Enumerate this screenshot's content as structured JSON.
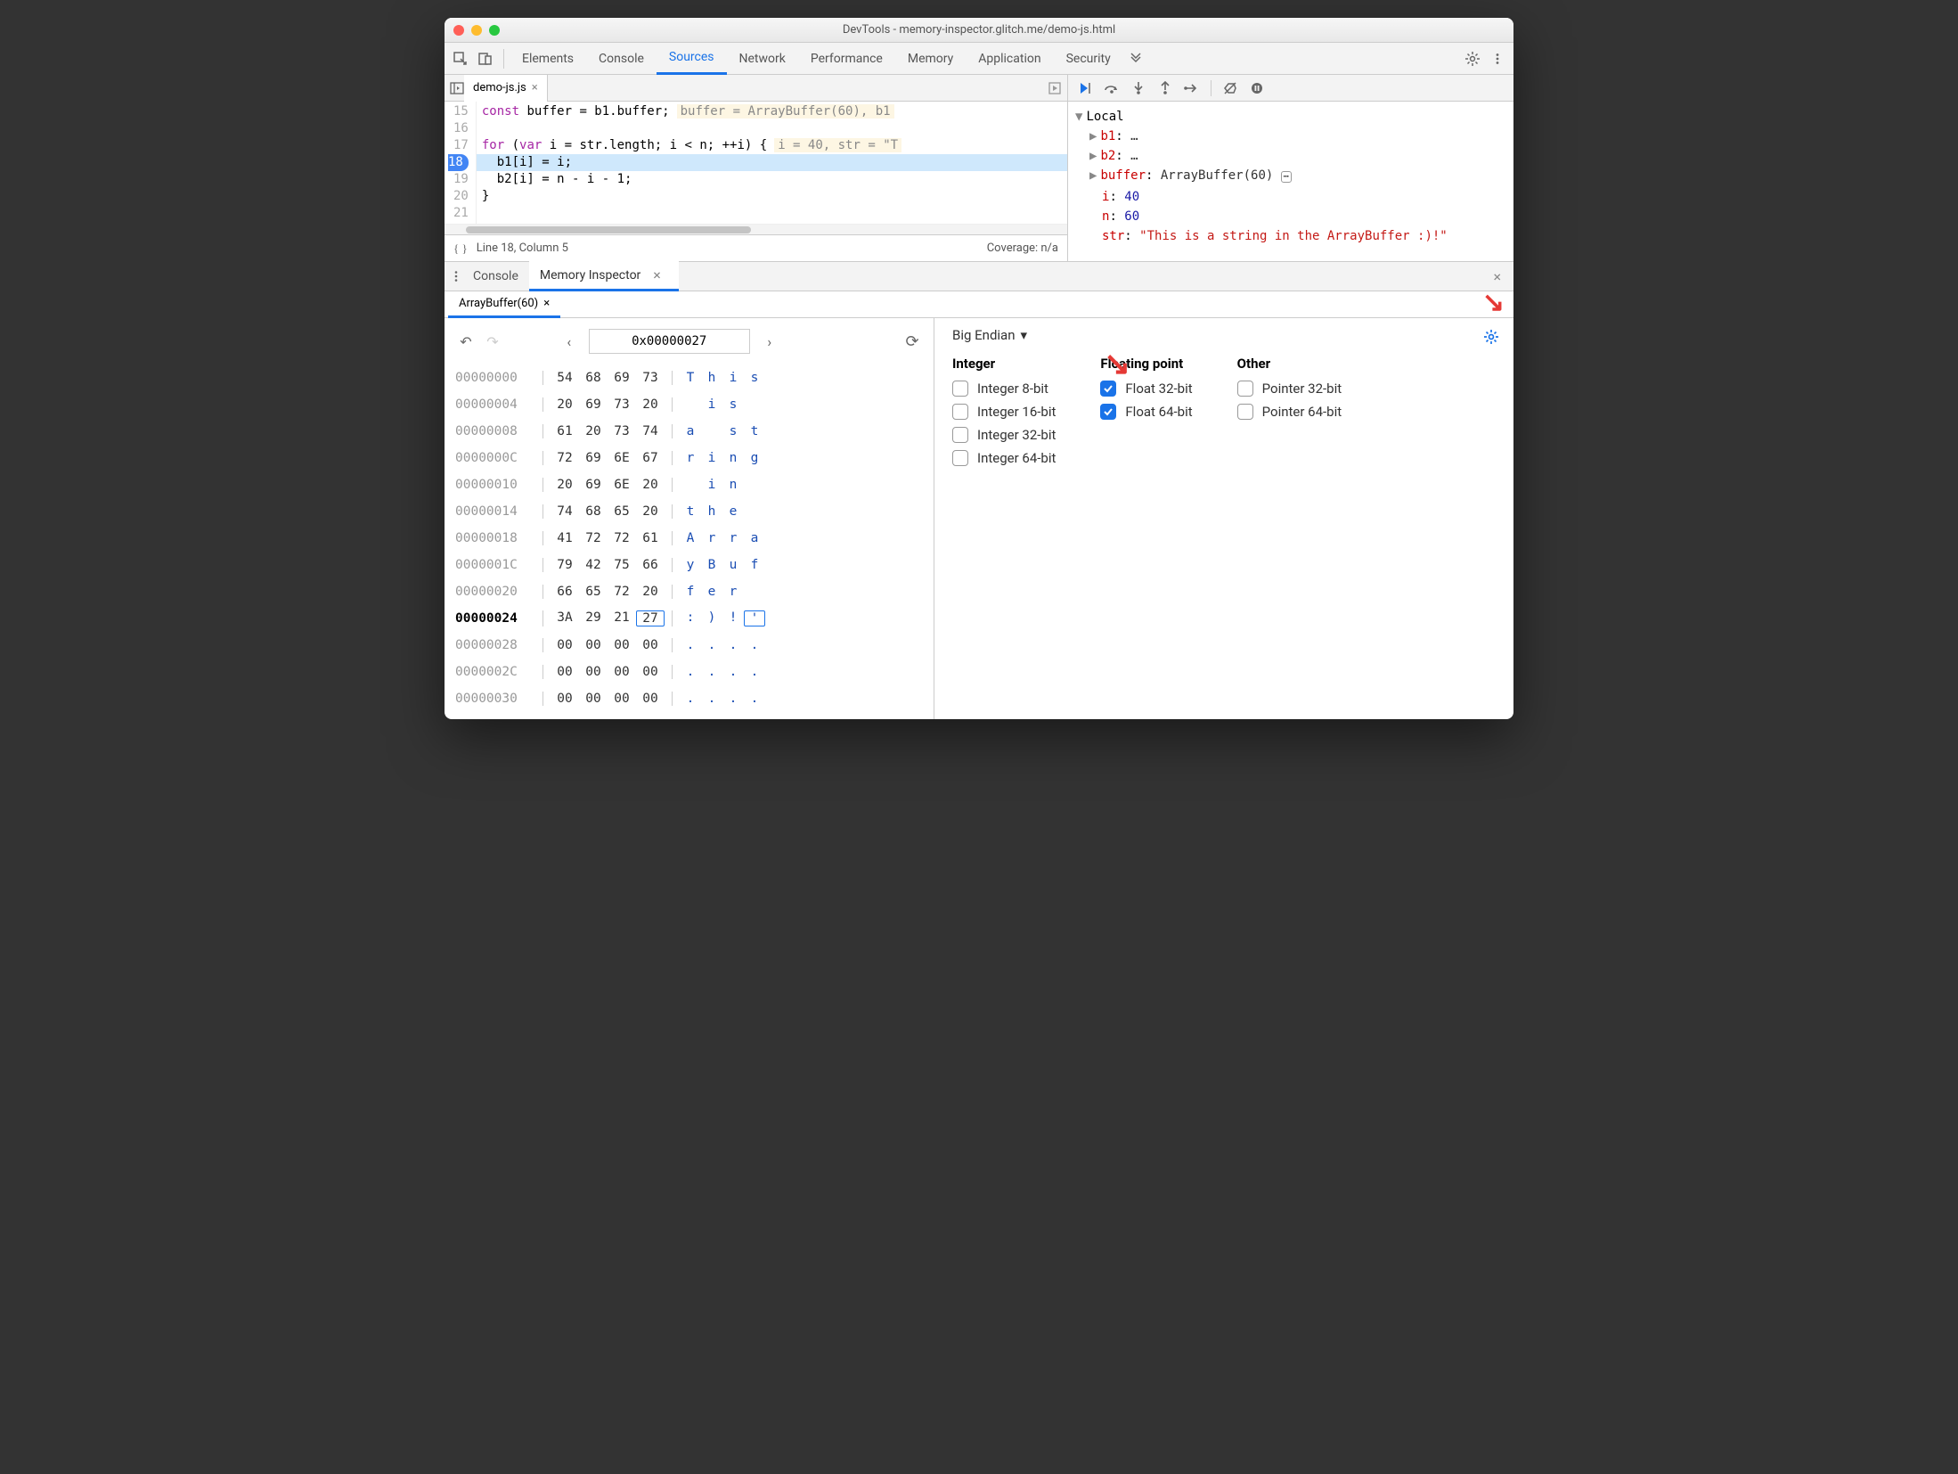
{
  "window": {
    "title": "DevTools - memory-inspector.glitch.me/demo-js.html"
  },
  "tabs": [
    "Elements",
    "Console",
    "Sources",
    "Network",
    "Performance",
    "Memory",
    "Application",
    "Security"
  ],
  "active_tab": "Sources",
  "file_tab": {
    "name": "demo-js.js"
  },
  "code": {
    "lines": [
      {
        "n": 15,
        "text": "const buffer = b1.buffer;",
        "hint": "buffer = ArrayBuffer(60), b1"
      },
      {
        "n": 16,
        "text": ""
      },
      {
        "n": 17,
        "text": "for (var i = str.length; i < n; ++i) {",
        "hint": "i = 40, str = \"T"
      },
      {
        "n": 18,
        "text": "  b1[i] = i;",
        "bp": true
      },
      {
        "n": 19,
        "text": "  b2[i] = n - i - 1;"
      },
      {
        "n": 20,
        "text": "}"
      },
      {
        "n": 21,
        "text": ""
      }
    ],
    "status": {
      "pos": "Line 18, Column 5",
      "coverage": "Coverage: n/a"
    }
  },
  "scope": {
    "title": "Local",
    "items": [
      {
        "k": "b1",
        "v": "…",
        "expandable": true
      },
      {
        "k": "b2",
        "v": "…",
        "expandable": true
      },
      {
        "k": "buffer",
        "v": "ArrayBuffer(60)",
        "icon": true,
        "expandable": true
      },
      {
        "k": "i",
        "v": "40",
        "num": true
      },
      {
        "k": "n",
        "v": "60",
        "num": true
      },
      {
        "k": "str",
        "v": "\"This is a string in the ArrayBuffer :)!\"",
        "str": true
      }
    ]
  },
  "drawer": {
    "tabs": [
      "Console",
      "Memory Inspector"
    ],
    "active": "Memory Inspector"
  },
  "mi": {
    "buffer_tab": "ArrayBuffer(60)",
    "address": "0x00000027",
    "endian": "Big Endian",
    "rows": [
      {
        "addr": "00000000",
        "bytes": [
          "54",
          "68",
          "69",
          "73"
        ],
        "ascii": [
          "T",
          "h",
          "i",
          "s"
        ]
      },
      {
        "addr": "00000004",
        "bytes": [
          "20",
          "69",
          "73",
          "20"
        ],
        "ascii": [
          " ",
          "i",
          "s",
          " "
        ]
      },
      {
        "addr": "00000008",
        "bytes": [
          "61",
          "20",
          "73",
          "74"
        ],
        "ascii": [
          "a",
          " ",
          "s",
          "t"
        ]
      },
      {
        "addr": "0000000C",
        "bytes": [
          "72",
          "69",
          "6E",
          "67"
        ],
        "ascii": [
          "r",
          "i",
          "n",
          "g"
        ]
      },
      {
        "addr": "00000010",
        "bytes": [
          "20",
          "69",
          "6E",
          "20"
        ],
        "ascii": [
          " ",
          "i",
          "n",
          " "
        ]
      },
      {
        "addr": "00000014",
        "bytes": [
          "74",
          "68",
          "65",
          "20"
        ],
        "ascii": [
          "t",
          "h",
          "e",
          " "
        ]
      },
      {
        "addr": "00000018",
        "bytes": [
          "41",
          "72",
          "72",
          "61"
        ],
        "ascii": [
          "A",
          "r",
          "r",
          "a"
        ]
      },
      {
        "addr": "0000001C",
        "bytes": [
          "79",
          "42",
          "75",
          "66"
        ],
        "ascii": [
          "y",
          "B",
          "u",
          "f"
        ]
      },
      {
        "addr": "00000020",
        "bytes": [
          "66",
          "65",
          "72",
          "20"
        ],
        "ascii": [
          "f",
          "e",
          "r",
          " "
        ]
      },
      {
        "addr": "00000024",
        "bytes": [
          "3A",
          "29",
          "21",
          "27"
        ],
        "ascii": [
          ":",
          ")",
          "!",
          "'"
        ],
        "sel_byte": 3,
        "sel_ascii": 3,
        "bold": true
      },
      {
        "addr": "00000028",
        "bytes": [
          "00",
          "00",
          "00",
          "00"
        ],
        "ascii": [
          ".",
          ".",
          ".",
          "."
        ]
      },
      {
        "addr": "0000002C",
        "bytes": [
          "00",
          "00",
          "00",
          "00"
        ],
        "ascii": [
          ".",
          ".",
          ".",
          "."
        ]
      },
      {
        "addr": "00000030",
        "bytes": [
          "00",
          "00",
          "00",
          "00"
        ],
        "ascii": [
          ".",
          ".",
          ".",
          "."
        ]
      }
    ],
    "types": {
      "integer": {
        "title": "Integer",
        "items": [
          {
            "label": "Integer 8-bit",
            "checked": false
          },
          {
            "label": "Integer 16-bit",
            "checked": false
          },
          {
            "label": "Integer 32-bit",
            "checked": false
          },
          {
            "label": "Integer 64-bit",
            "checked": false
          }
        ]
      },
      "float": {
        "title": "Floating point",
        "items": [
          {
            "label": "Float 32-bit",
            "checked": true
          },
          {
            "label": "Float 64-bit",
            "checked": true
          }
        ]
      },
      "other": {
        "title": "Other",
        "items": [
          {
            "label": "Pointer 32-bit",
            "checked": false
          },
          {
            "label": "Pointer 64-bit",
            "checked": false
          }
        ]
      }
    }
  }
}
